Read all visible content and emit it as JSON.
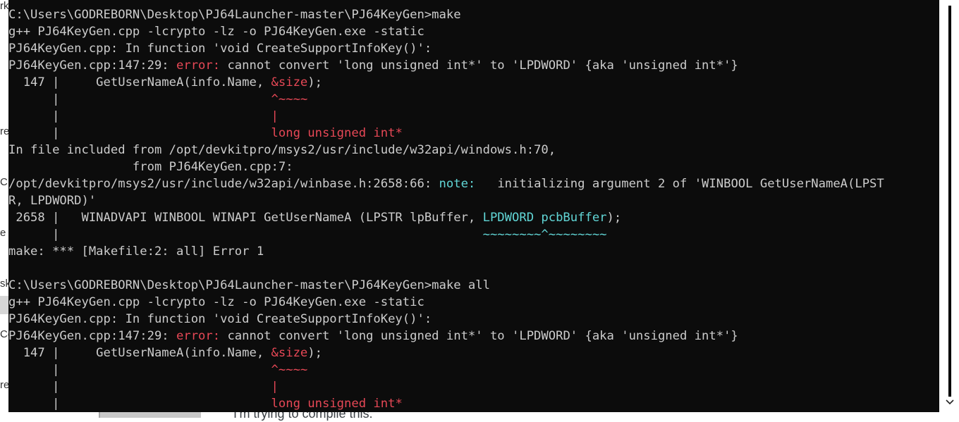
{
  "background_page": {
    "fragments": [
      {
        "text": "rk"
      },
      {
        "text": "re"
      },
      {
        "text": "C"
      },
      {
        "text": "e"
      },
      {
        "text": "sk"
      },
      {
        "text": "Co"
      },
      {
        "text": "re"
      }
    ],
    "question_text": "I'm trying to compile this:"
  },
  "terminal": {
    "lines": [
      [
        {
          "t": "C:\\Users\\GODREBORN\\Desktop\\PJ64Launcher-master\\PJ64KeyGen>make",
          "c": ""
        }
      ],
      [
        {
          "t": "g++ PJ64KeyGen.cpp -lcrypto -lz -o PJ64KeyGen.exe -static",
          "c": ""
        }
      ],
      [
        {
          "t": "PJ64KeyGen.cpp: In function 'void CreateSupportInfoKey()':",
          "c": ""
        }
      ],
      [
        {
          "t": "PJ64KeyGen.cpp:147:29: ",
          "c": ""
        },
        {
          "t": "error:",
          "c": "err"
        },
        {
          "t": " cannot convert 'long unsigned int*' to 'LPDWORD' {aka 'unsigned int*'}",
          "c": ""
        }
      ],
      [
        {
          "t": "  147 |     GetUserNameA(info.Name, ",
          "c": ""
        },
        {
          "t": "&size",
          "c": "err"
        },
        {
          "t": ");",
          "c": ""
        }
      ],
      [
        {
          "t": "      |                             ",
          "c": ""
        },
        {
          "t": "^~~~~",
          "c": "err"
        }
      ],
      [
        {
          "t": "      |                             ",
          "c": ""
        },
        {
          "t": "|",
          "c": "err"
        }
      ],
      [
        {
          "t": "      |                             ",
          "c": ""
        },
        {
          "t": "long unsigned int*",
          "c": "err"
        }
      ],
      [
        {
          "t": "In file included from /opt/devkitpro/msys2/usr/include/w32api/windows.h:70,",
          "c": ""
        }
      ],
      [
        {
          "t": "                 from PJ64KeyGen.cpp:7:",
          "c": ""
        }
      ],
      [
        {
          "t": "/opt/devkitpro/msys2/usr/include/w32api/winbase.h:2658:66: ",
          "c": ""
        },
        {
          "t": "note:",
          "c": "note"
        },
        {
          "t": "   initializing argument 2 of 'WINBOOL GetUserNameA(LPST",
          "c": ""
        }
      ],
      [
        {
          "t": "R, LPDWORD)'",
          "c": ""
        }
      ],
      [
        {
          "t": " 2658 |   WINADVAPI WINBOOL WINAPI GetUserNameA (LPSTR lpBuffer, ",
          "c": ""
        },
        {
          "t": "LPDWORD pcbBuffer",
          "c": "note"
        },
        {
          "t": ");",
          "c": ""
        }
      ],
      [
        {
          "t": "      |                                                          ",
          "c": ""
        },
        {
          "t": "~~~~~~~~^~~~~~~~~",
          "c": "note"
        }
      ],
      [
        {
          "t": "make: *** [Makefile:2: all] Error 1",
          "c": ""
        }
      ],
      [
        {
          "t": "",
          "c": ""
        }
      ],
      [
        {
          "t": "C:\\Users\\GODREBORN\\Desktop\\PJ64Launcher-master\\PJ64KeyGen>make all",
          "c": ""
        }
      ],
      [
        {
          "t": "g++ PJ64KeyGen.cpp -lcrypto -lz -o PJ64KeyGen.exe -static",
          "c": ""
        }
      ],
      [
        {
          "t": "PJ64KeyGen.cpp: In function 'void CreateSupportInfoKey()':",
          "c": ""
        }
      ],
      [
        {
          "t": "PJ64KeyGen.cpp:147:29: ",
          "c": ""
        },
        {
          "t": "error:",
          "c": "err"
        },
        {
          "t": " cannot convert 'long unsigned int*' to 'LPDWORD' {aka 'unsigned int*'}",
          "c": ""
        }
      ],
      [
        {
          "t": "  147 |     GetUserNameA(info.Name, ",
          "c": ""
        },
        {
          "t": "&size",
          "c": "err"
        },
        {
          "t": ");",
          "c": ""
        }
      ],
      [
        {
          "t": "      |                             ",
          "c": ""
        },
        {
          "t": "^~~~~",
          "c": "err"
        }
      ],
      [
        {
          "t": "      |                             ",
          "c": ""
        },
        {
          "t": "|",
          "c": "err"
        }
      ],
      [
        {
          "t": "      |                             ",
          "c": ""
        },
        {
          "t": "long unsigned int*",
          "c": "err"
        }
      ]
    ]
  },
  "colors": {
    "terminal_bg": "#0c0c0c",
    "terminal_fg": "#cccccc",
    "error": "#e74856",
    "note": "#61d6d6"
  },
  "icons": {
    "scroll_down": "chevron-down-icon"
  }
}
